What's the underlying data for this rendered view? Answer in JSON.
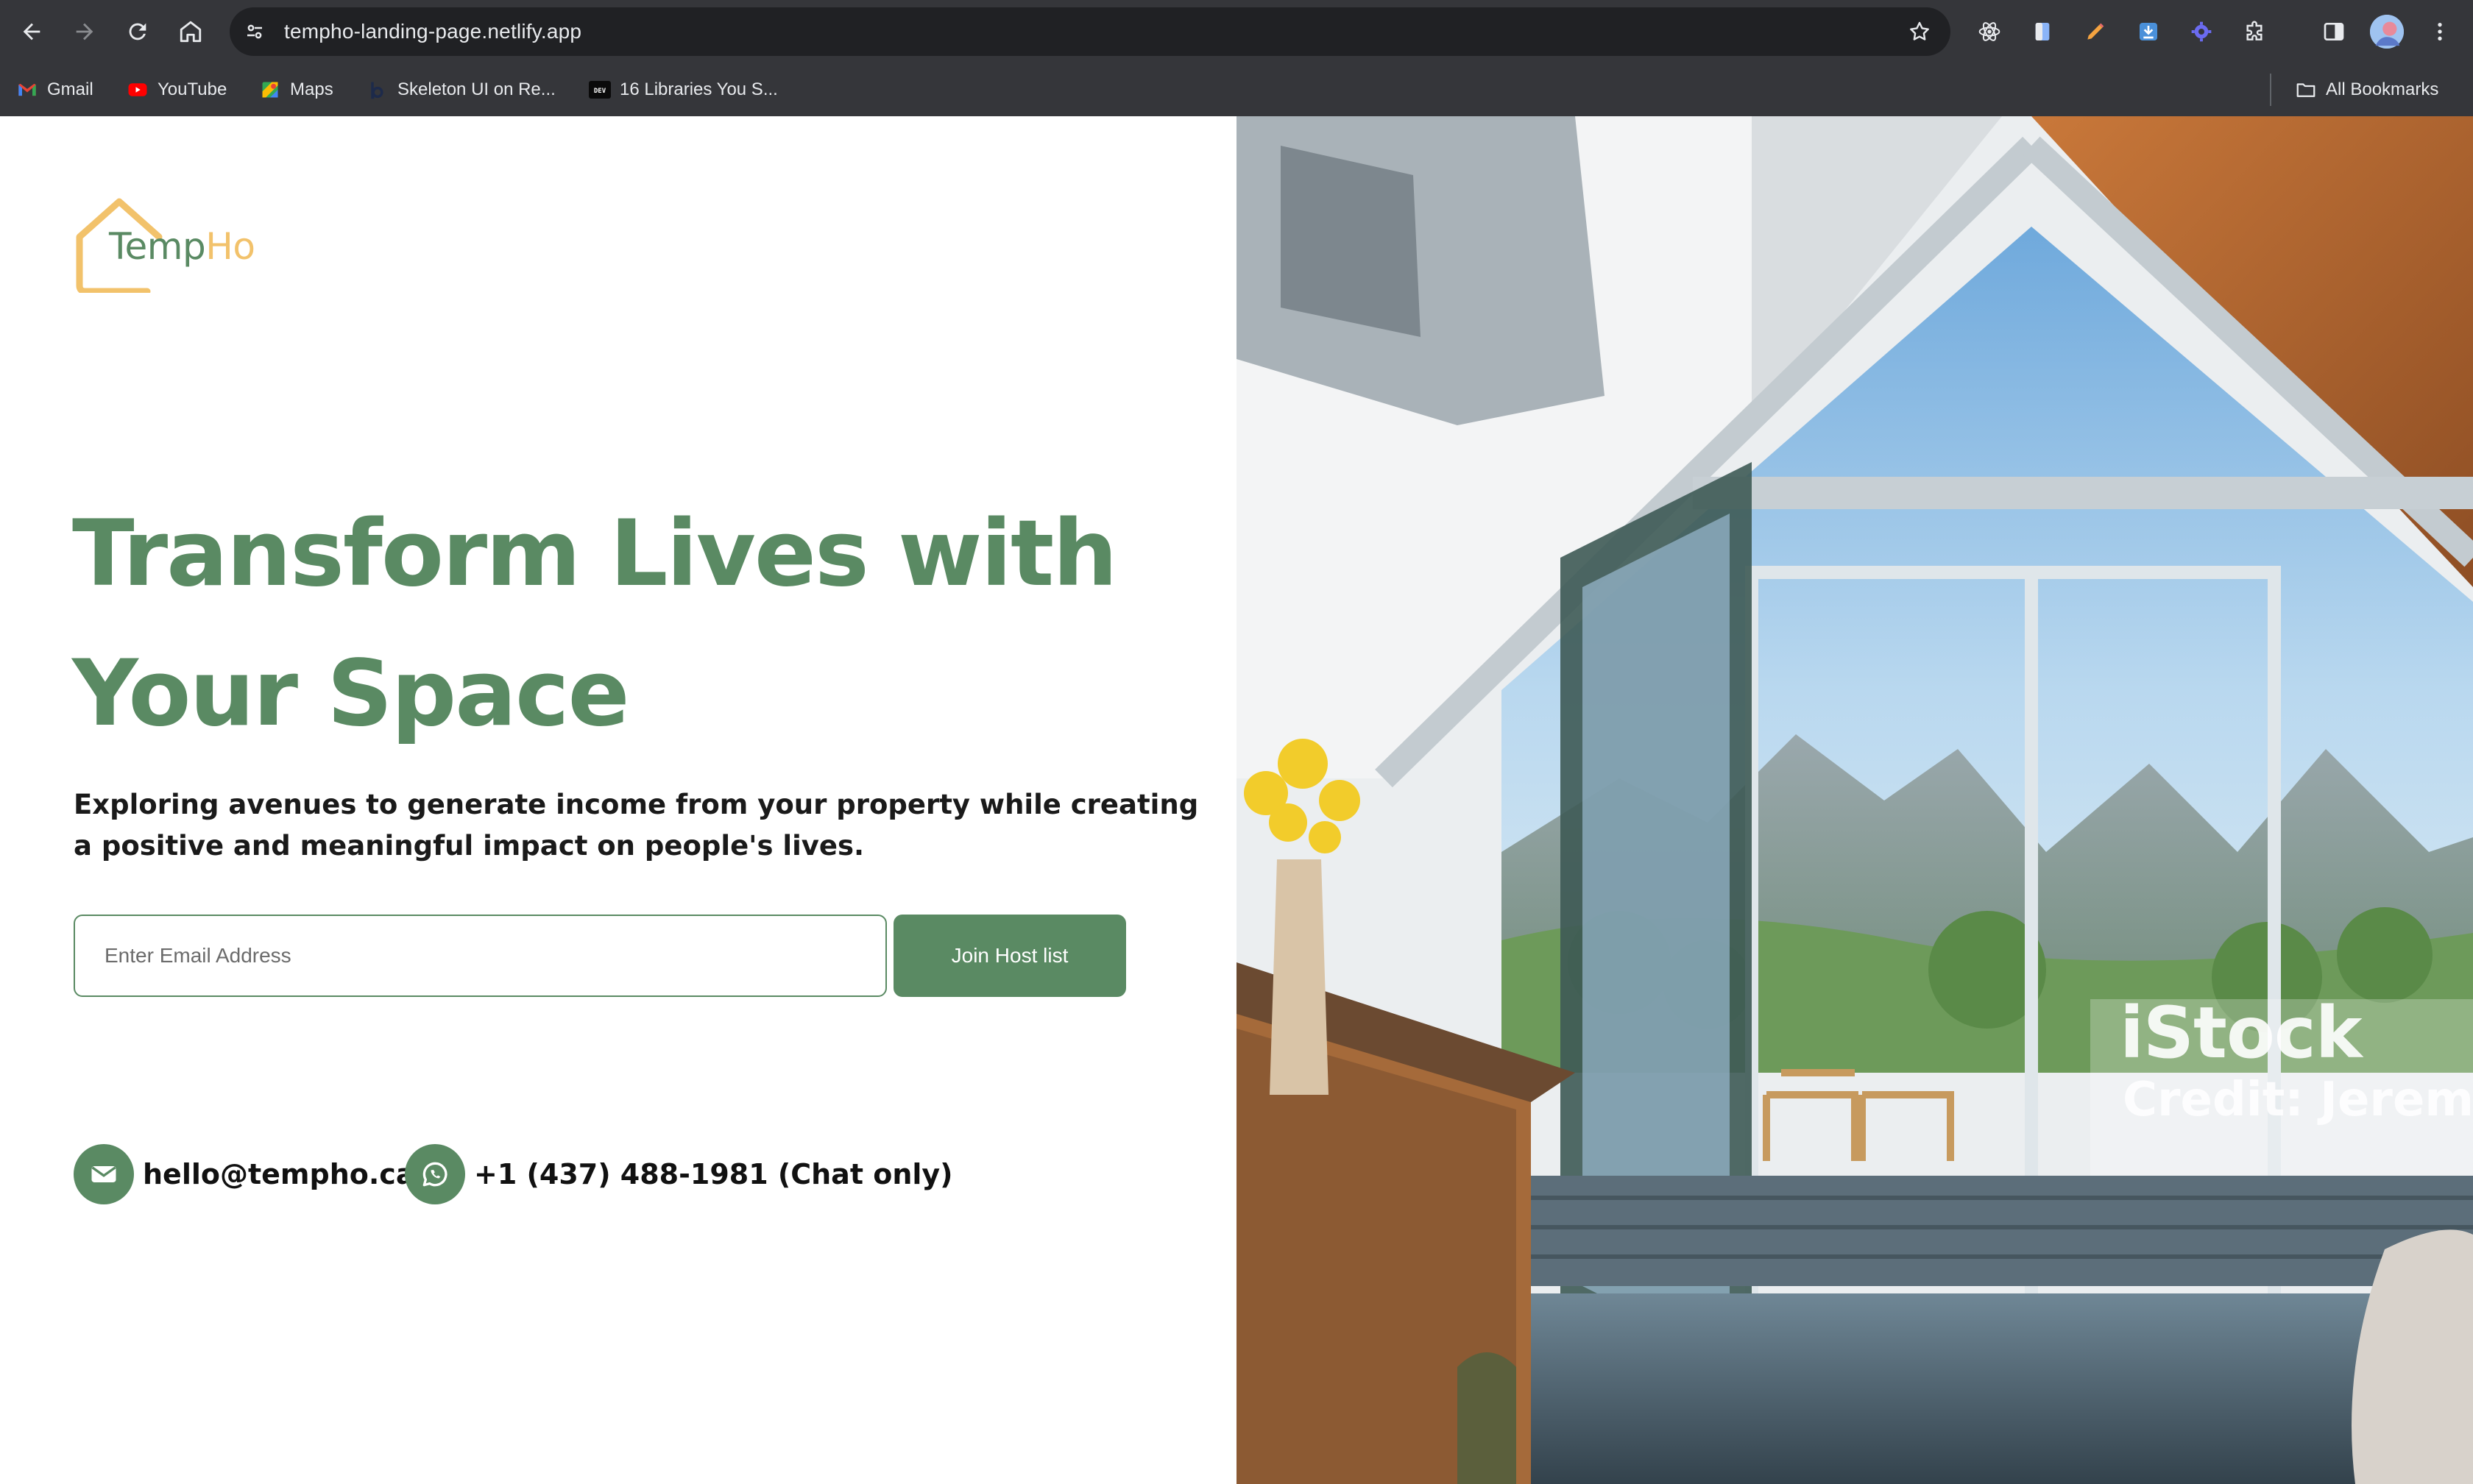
{
  "browser": {
    "url": "tempho-landing-page.netlify.app",
    "bookmarks": [
      {
        "label": "Gmail",
        "icon": "gmail-icon"
      },
      {
        "label": "YouTube",
        "icon": "youtube-icon"
      },
      {
        "label": "Maps",
        "icon": "maps-icon"
      },
      {
        "label": "Skeleton UI on Re...",
        "icon": "skeleton-icon"
      },
      {
        "label": "16 Libraries You S...",
        "icon": "dev-icon"
      }
    ],
    "all_bookmarks_label": "All Bookmarks"
  },
  "logo": {
    "text_a": "Temp",
    "text_b": "Ho"
  },
  "hero": {
    "headline_line1": "Transform Lives with",
    "headline_line2": "Your Space",
    "subheadline": "Exploring avenues to generate income from your property while creating a positive and meaningful impact on people's lives."
  },
  "signup": {
    "email_placeholder": "Enter Email Address",
    "email_value": "",
    "button_label": "Join Host list"
  },
  "contacts": {
    "email": "hello@tempho.ca",
    "phone": "+1 (437) 488-1981 (Chat only)"
  },
  "image": {
    "watermark_brand": "iStock",
    "watermark_credit": "Credit: Jeremy"
  },
  "colors": {
    "brand_green": "#5a8a63",
    "logo_orange": "#f2c26b",
    "chrome_bg": "#35363a",
    "omnibox_bg": "#202124"
  }
}
